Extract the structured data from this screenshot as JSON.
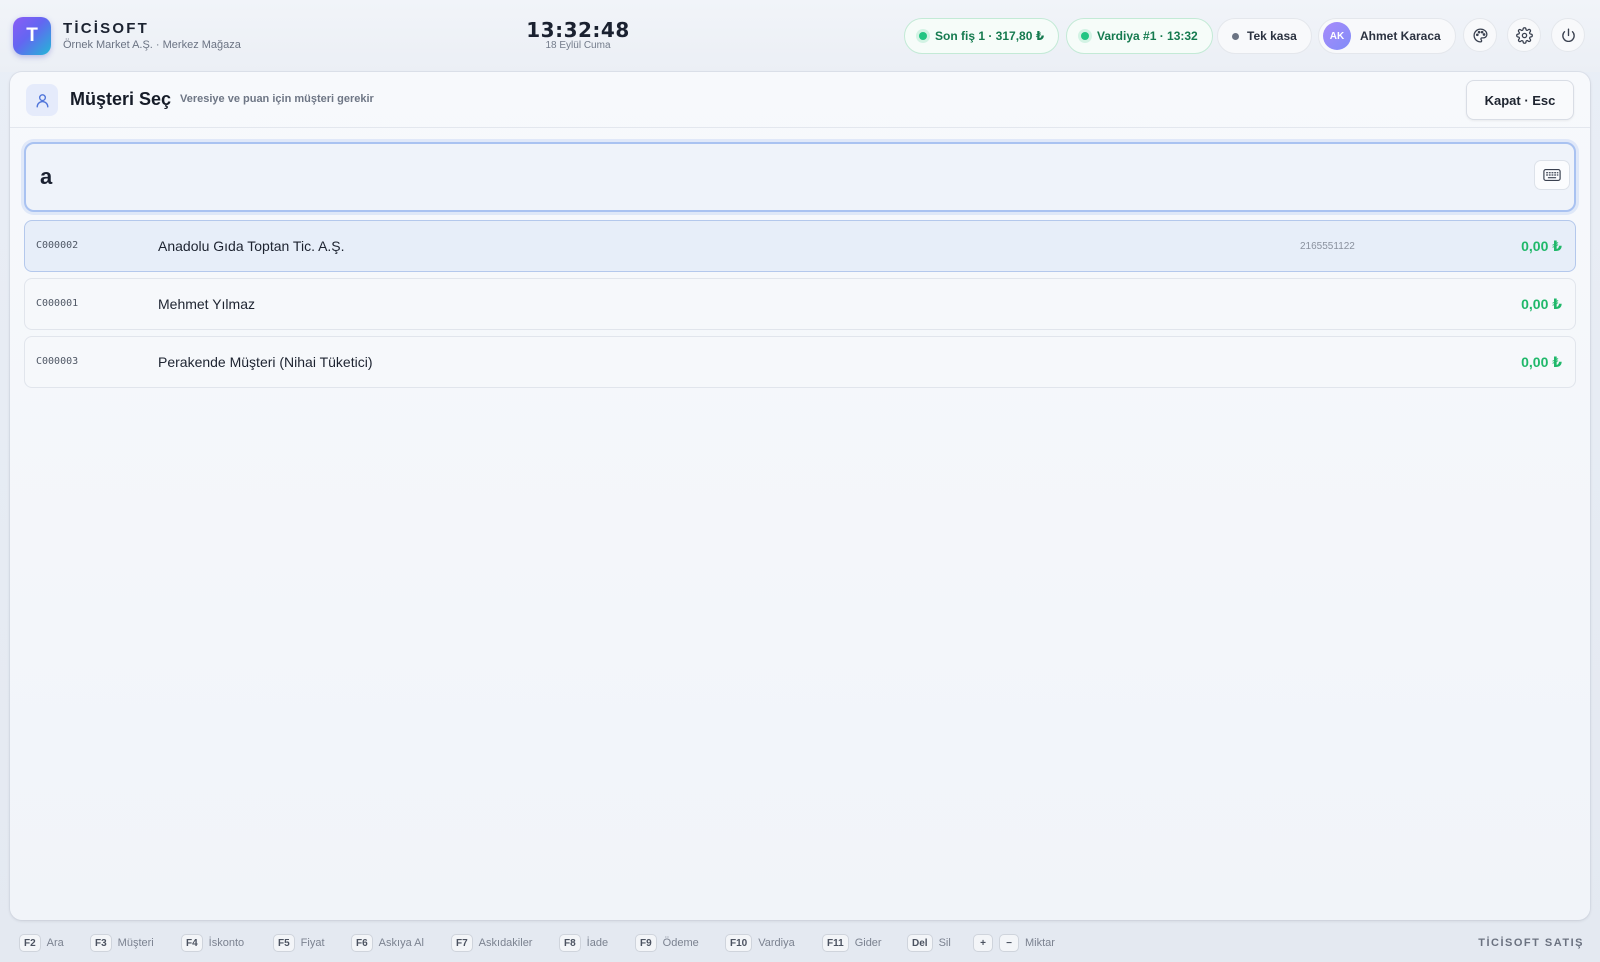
{
  "app": {
    "logo_letter": "T",
    "brand": "TİCİSOFT",
    "company": "Örnek Market A.Ş. · Merkez Mağaza",
    "time": "13:32:48",
    "date": "18 Eylül Cuma"
  },
  "status": {
    "last_receipt": "Son fiş 1 · 317,80 ₺",
    "shift": "Vardiya #1 · 13:32",
    "register": "Tek kasa",
    "user_initials": "AK",
    "user_name": "Ahmet Karaca"
  },
  "icons": {
    "theme": "palette-icon",
    "settings": "gear-icon",
    "power": "power-icon"
  },
  "dialog": {
    "title": "Müşteri Seç",
    "subtitle": "Veresiye ve puan için müşteri gerekir",
    "close_label": "Kapat · Esc",
    "search_value": "a"
  },
  "customers": [
    {
      "code": "C000002",
      "name": "Anadolu Gıda Toptan Tic. A.Ş.",
      "phone": "2165551122",
      "balance": "0,00 ₺",
      "selected": true
    },
    {
      "code": "C000001",
      "name": "Mehmet Yılmaz",
      "phone": "",
      "balance": "0,00 ₺",
      "selected": false
    },
    {
      "code": "C000003",
      "name": "Perakende Müşteri (Nihai Tüketici)",
      "phone": "",
      "balance": "0,00 ₺",
      "selected": false
    }
  ],
  "shortcuts": [
    {
      "key": "F2",
      "label": "Ara"
    },
    {
      "key": "F3",
      "label": "Müşteri"
    },
    {
      "key": "F4",
      "label": "İskonto"
    },
    {
      "key": "F5",
      "label": "Fiyat"
    },
    {
      "key": "F6",
      "label": "Askıya Al"
    },
    {
      "key": "F7",
      "label": "Askıdakiler"
    },
    {
      "key": "F8",
      "label": "İade"
    },
    {
      "key": "F9",
      "label": "Ödeme"
    },
    {
      "key": "F10",
      "label": "Vardiya"
    },
    {
      "key": "F11",
      "label": "Gider"
    },
    {
      "key": "Del",
      "label": "Sil"
    },
    {
      "key": "+",
      "label": ""
    },
    {
      "key": "−",
      "label": "Miktar"
    }
  ],
  "footer_brand": "TİCİSOFT SATIŞ",
  "colors": {
    "accent": "#6366f1",
    "positive": "#20b86a",
    "status_green": "#22c582"
  }
}
